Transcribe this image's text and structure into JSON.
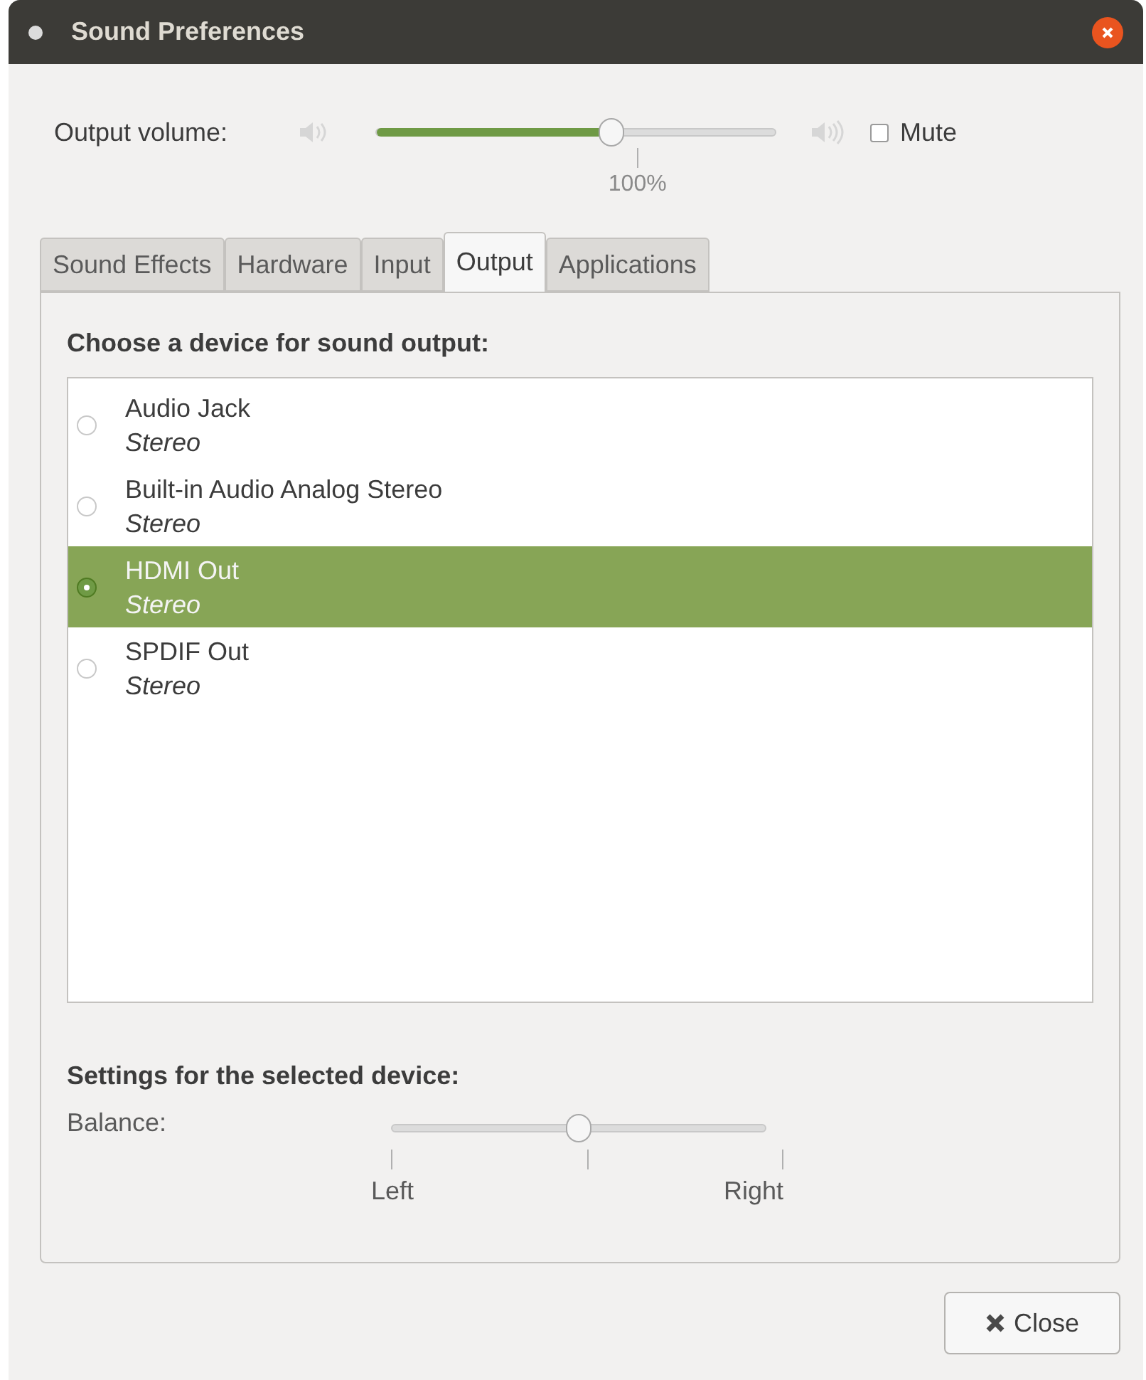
{
  "window": {
    "title": "Sound Preferences"
  },
  "output_volume": {
    "label": "Output volume:",
    "level": 0.59,
    "reading": "100%",
    "mute": {
      "label": "Mute",
      "checked": false
    }
  },
  "tabs": [
    {
      "label": "Sound Effects",
      "selected": false
    },
    {
      "label": "Hardware",
      "selected": false
    },
    {
      "label": "Input",
      "selected": false
    },
    {
      "label": "Output",
      "selected": true
    },
    {
      "label": "Applications",
      "selected": false
    }
  ],
  "device_heading": "Choose a device for sound output:",
  "devices": [
    {
      "name": "Audio Jack",
      "profile": "Stereo",
      "selected": false
    },
    {
      "name": "Built-in Audio Analog Stereo",
      "profile": "Stereo",
      "selected": false
    },
    {
      "name": "HDMI Out",
      "profile": "Stereo",
      "selected": true
    },
    {
      "name": "SPDIF Out",
      "profile": "Stereo",
      "selected": false
    }
  ],
  "settings_heading": "Settings for the selected device:",
  "balance": {
    "label": "Balance:",
    "level": 0.5,
    "left": "Left",
    "right": "Right"
  },
  "buttons": [
    {
      "label": "Close"
    }
  ]
}
